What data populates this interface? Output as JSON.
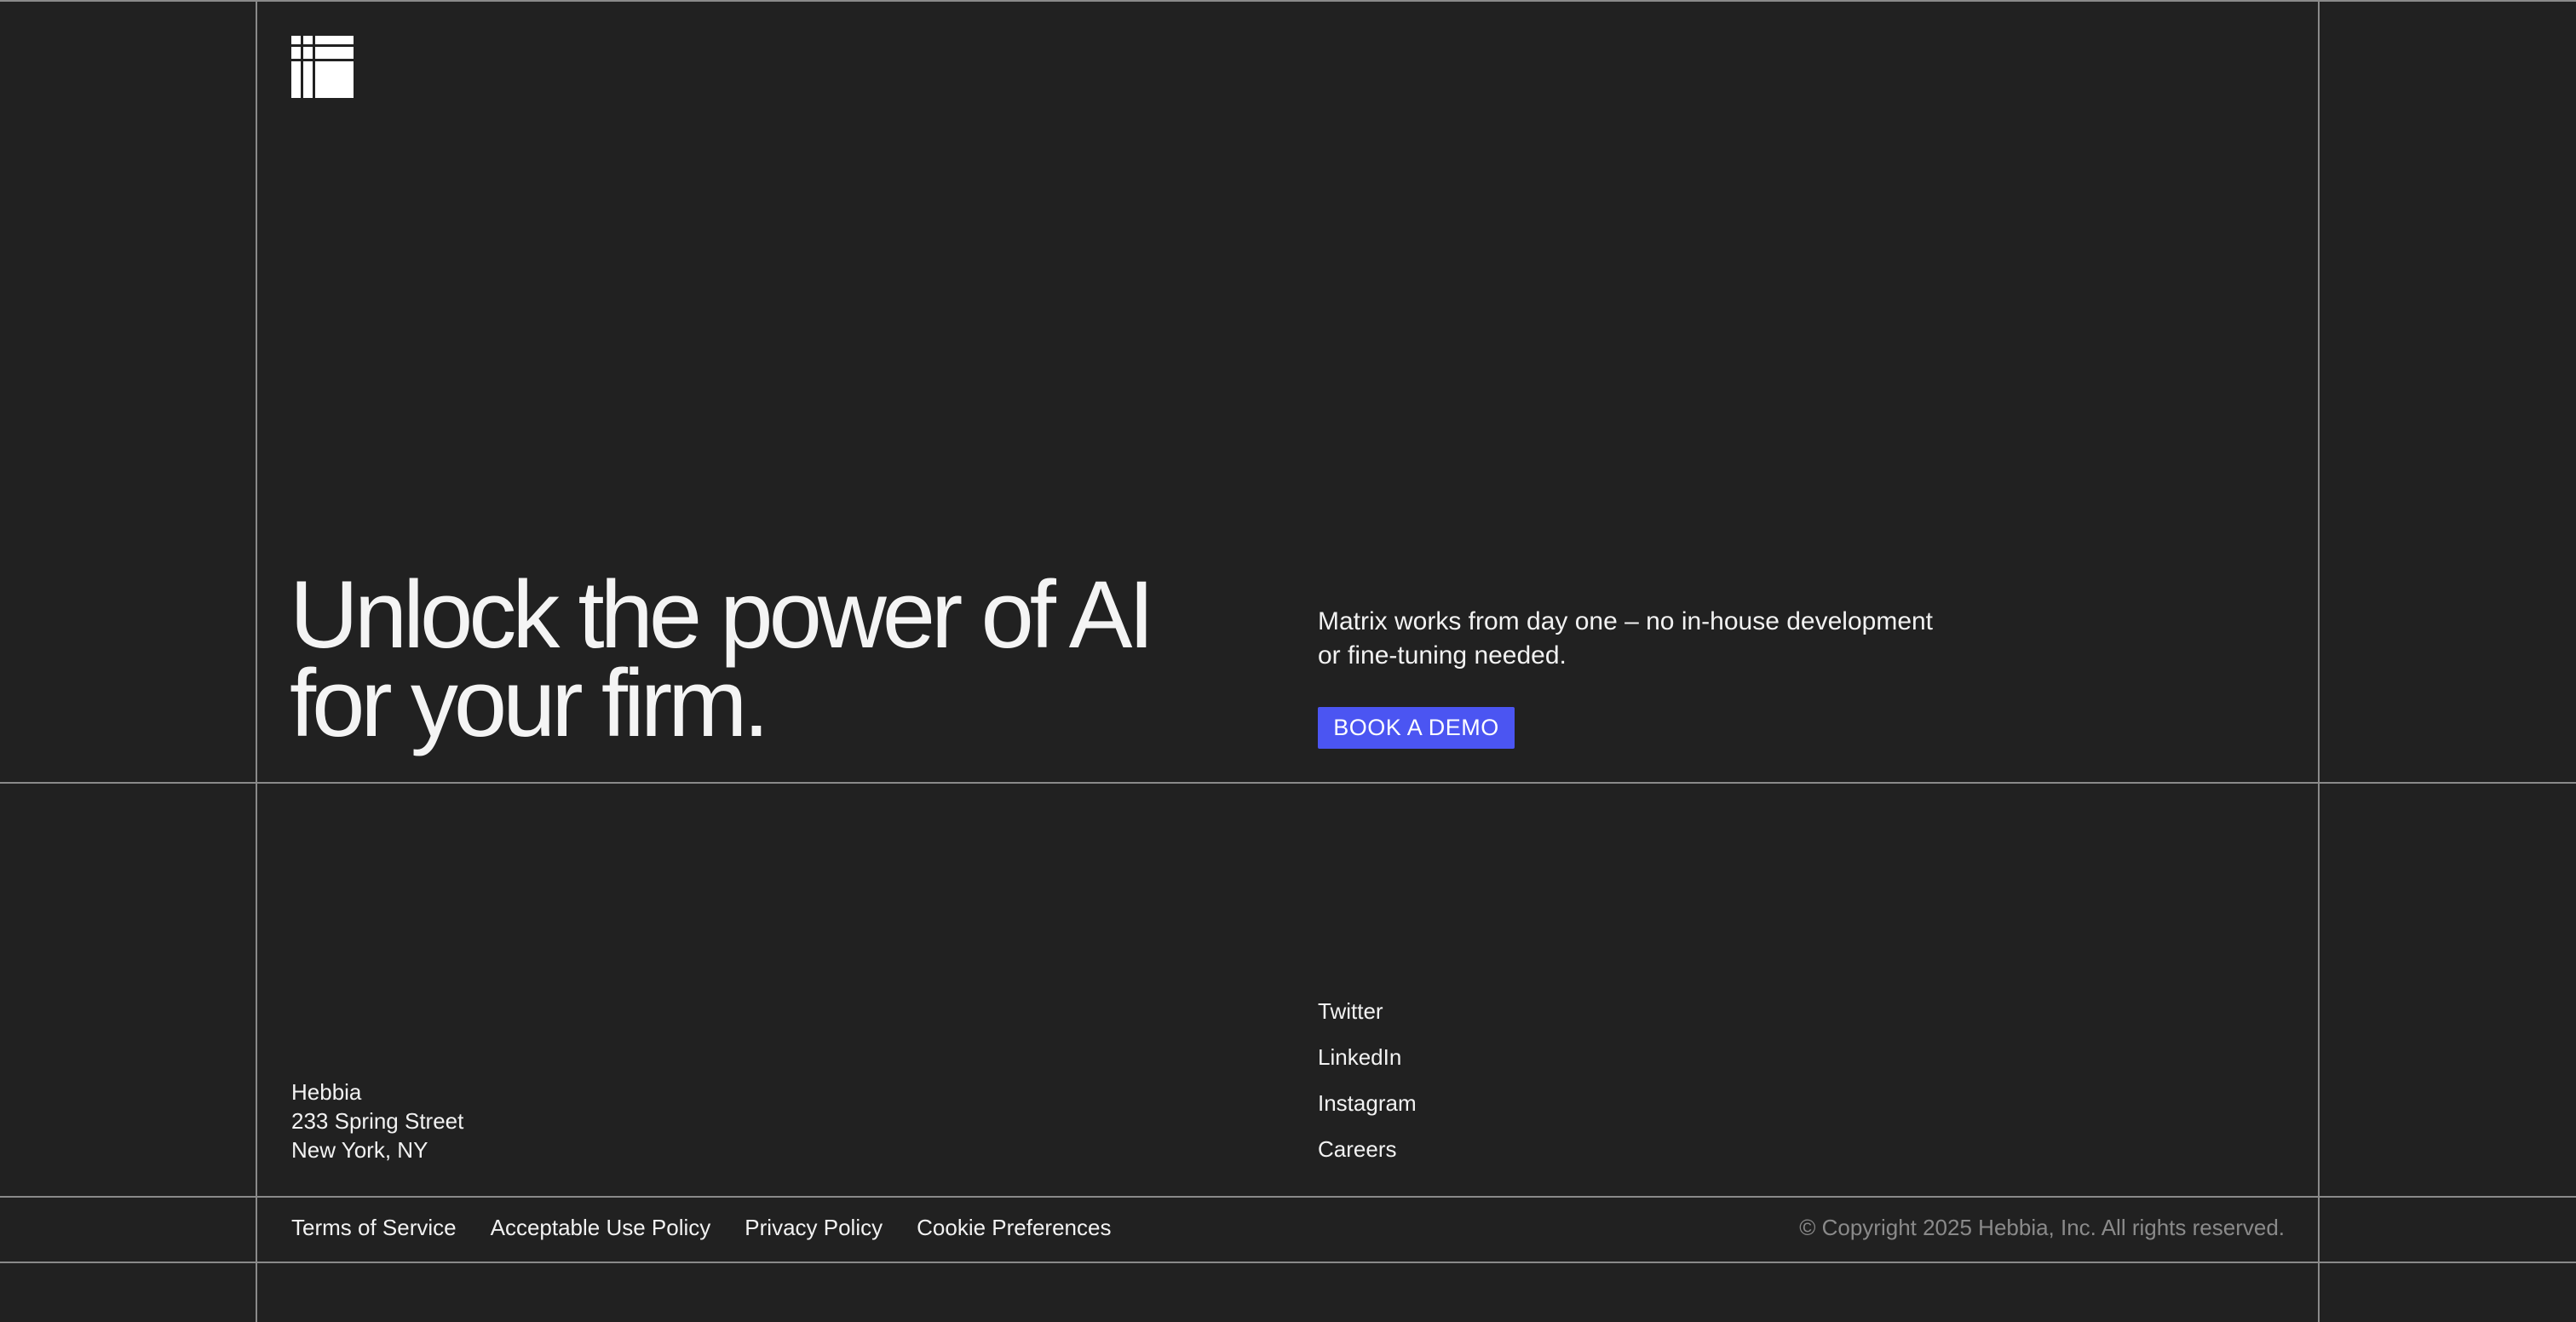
{
  "logo": {
    "icon": "hebbia-grid-logo"
  },
  "hero": {
    "title_line1": "Unlock the power of AI",
    "title_line2": "for your firm.",
    "subtitle_line1": "Matrix works from day one – no in-house development",
    "subtitle_line2": "or fine-tuning needed.",
    "cta_label": "BOOK A DEMO"
  },
  "address": {
    "company": "Hebbia",
    "street": "233 Spring Street",
    "city": "New York, NY"
  },
  "social": {
    "twitter": "Twitter",
    "linkedin": "LinkedIn",
    "instagram": "Instagram",
    "careers": "Careers"
  },
  "footer": {
    "terms": "Terms of Service",
    "acceptable_use": "Acceptable Use Policy",
    "privacy": "Privacy Policy",
    "cookies": "Cookie Preferences",
    "copyright": "© Copyright 2025 Hebbia, Inc. All rights reserved."
  },
  "colors": {
    "background": "#212121",
    "grid_line": "#8a8a8a",
    "text": "#f2f2f2",
    "cta": "#4b55f2",
    "muted": "#8a8a8a"
  }
}
